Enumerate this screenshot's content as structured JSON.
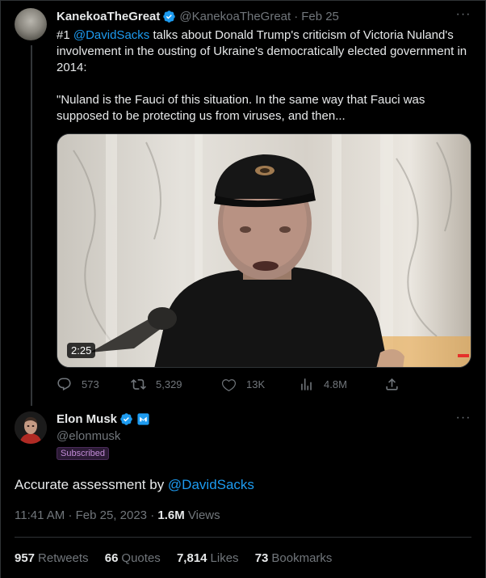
{
  "tweet1": {
    "display_name": "KanekoaTheGreat",
    "handle": "@KanekoaTheGreat",
    "separator": "·",
    "date": "Feb 25",
    "text_prefix": "#1 ",
    "mention": "@DavidSacks",
    "text_rest": " talks about Donald Trump's criticism of Victoria Nuland's involvement in the ousting of Ukraine's democratically elected government in 2014:",
    "quote": "\"Nuland is the Fauci of this situation. In the same way that Fauci was supposed to be protecting us from viruses, and then...",
    "video_duration": "2:25",
    "replies": "573",
    "retweets": "5,329",
    "likes": "13K",
    "views": "4.8M"
  },
  "tweet2": {
    "display_name": "Elon Musk",
    "handle": "@elonmusk",
    "badge": "Subscribed",
    "text_prefix": "Accurate assessment by ",
    "mention": "@DavidSacks",
    "time": "11:41 AM",
    "date_sep": "·",
    "date": "Feb 25, 2023",
    "views_sep": "·",
    "views_count": "1.6M",
    "views_label": "Views",
    "stats": {
      "retweets_count": "957",
      "retweets_label": "Retweets",
      "quotes_count": "66",
      "quotes_label": "Quotes",
      "likes_count": "7,814",
      "likes_label": "Likes",
      "bookmarks_count": "73",
      "bookmarks_label": "Bookmarks"
    }
  },
  "colors": {
    "background": "#000000",
    "text": "#e7e9ea",
    "muted": "#71767b",
    "link": "#1d9bf0",
    "verified": "#1d9bf0"
  },
  "icons": [
    "more-icon",
    "verified-icon",
    "reply-icon",
    "retweet-icon",
    "like-icon",
    "views-icon",
    "share-icon",
    "business-badge-icon"
  ]
}
